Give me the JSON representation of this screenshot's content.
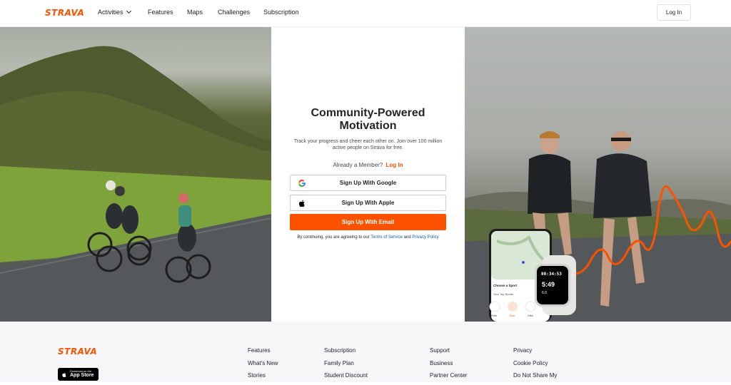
{
  "header": {
    "logo": "STRAVA",
    "nav": {
      "activities": "Activities",
      "features": "Features",
      "maps": "Maps",
      "challenges": "Challenges",
      "subscription": "Subscription"
    },
    "login_label": "Log In"
  },
  "hero": {
    "headline_line1": "Community-Powered",
    "headline_line2": "Motivation",
    "subtitle": "Track your progress and cheer each other on. Join over 100 million active people on Strava for free.",
    "member_text": "Already a Member?",
    "member_link": "Log In",
    "google_label": "Sign Up With Google",
    "apple_label": "Sign Up With Apple",
    "email_label": "Sign Up With Email",
    "terms_prefix": "By continuing, you are agreeing to our",
    "terms_link": "Terms of Service",
    "terms_and": "and",
    "privacy_link": "Privacy Policy",
    "phone": {
      "choose_sport": "Choose a Sport",
      "your_top_sports": "Your Top Sports",
      "sports": [
        "Ride",
        "Run",
        "Hike"
      ]
    },
    "watch": {
      "time": "00:34:53",
      "pace": "5:49",
      "distance": "6.0"
    }
  },
  "footer": {
    "logo": "STRAVA",
    "appstore_small": "Download on the",
    "appstore_big": "App Store",
    "col1": [
      "Features",
      "What's New",
      "Stories"
    ],
    "col2": [
      "Subscription",
      "Family Plan",
      "Student Discount"
    ],
    "col3": [
      "Support",
      "Business",
      "Partner Center"
    ],
    "col4": [
      "Privacy",
      "Cookie Policy",
      "Do Not Share My"
    ]
  },
  "colors": {
    "brand": "#fc5200",
    "link": "#0b5aa9"
  }
}
